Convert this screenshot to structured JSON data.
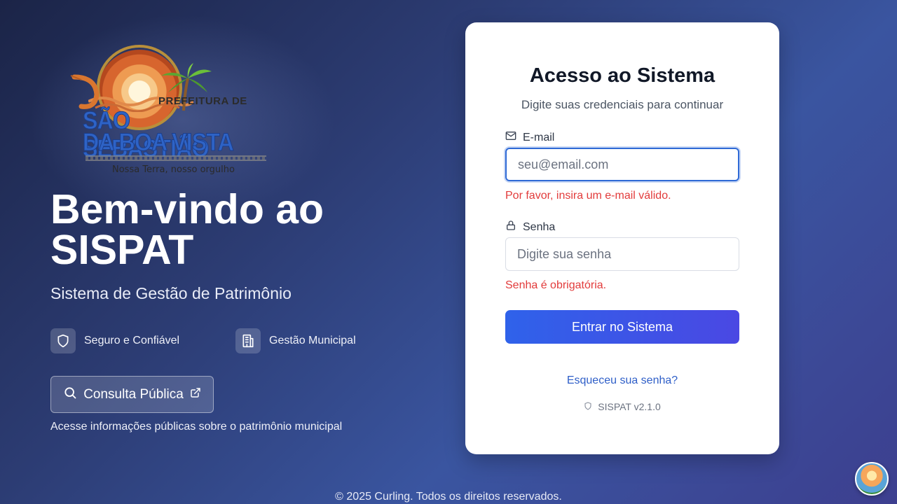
{
  "logo": {
    "line1": "PREFEITURA DE",
    "line2": "SÃO SEBASTIÃO",
    "line3": "DA BOA VISTA",
    "slogan": "Nossa Terra, nosso orgulho"
  },
  "hero": {
    "title": "Bem-vindo ao SISPAT",
    "subtitle": "Sistema de Gestão de Patrimônio",
    "features": [
      {
        "icon": "shield-icon",
        "label": "Seguro e Confiável"
      },
      {
        "icon": "building-icon",
        "label": "Gestão Municipal"
      }
    ],
    "consulta_label": "Consulta Pública",
    "consulta_note": "Acesse informações públicas sobre o patrimônio municipal"
  },
  "login": {
    "title": "Acesso ao Sistema",
    "subtitle": "Digite suas credenciais para continuar",
    "email_label": "E-mail",
    "email_placeholder": "seu@email.com",
    "email_error": "Por favor, insira um e-mail válido.",
    "password_label": "Senha",
    "password_placeholder": "Digite sua senha",
    "password_error": "Senha é obrigatória.",
    "submit_label": "Entrar no Sistema",
    "forgot_label": "Esqueceu sua senha?",
    "version": "SISPAT v2.1.0"
  },
  "footer": {
    "text": "© 2025 Curling. Todos os direitos reservados."
  },
  "colors": {
    "accent": "#2f62ea",
    "error": "#e23b3b",
    "link": "#2f5fc8"
  }
}
